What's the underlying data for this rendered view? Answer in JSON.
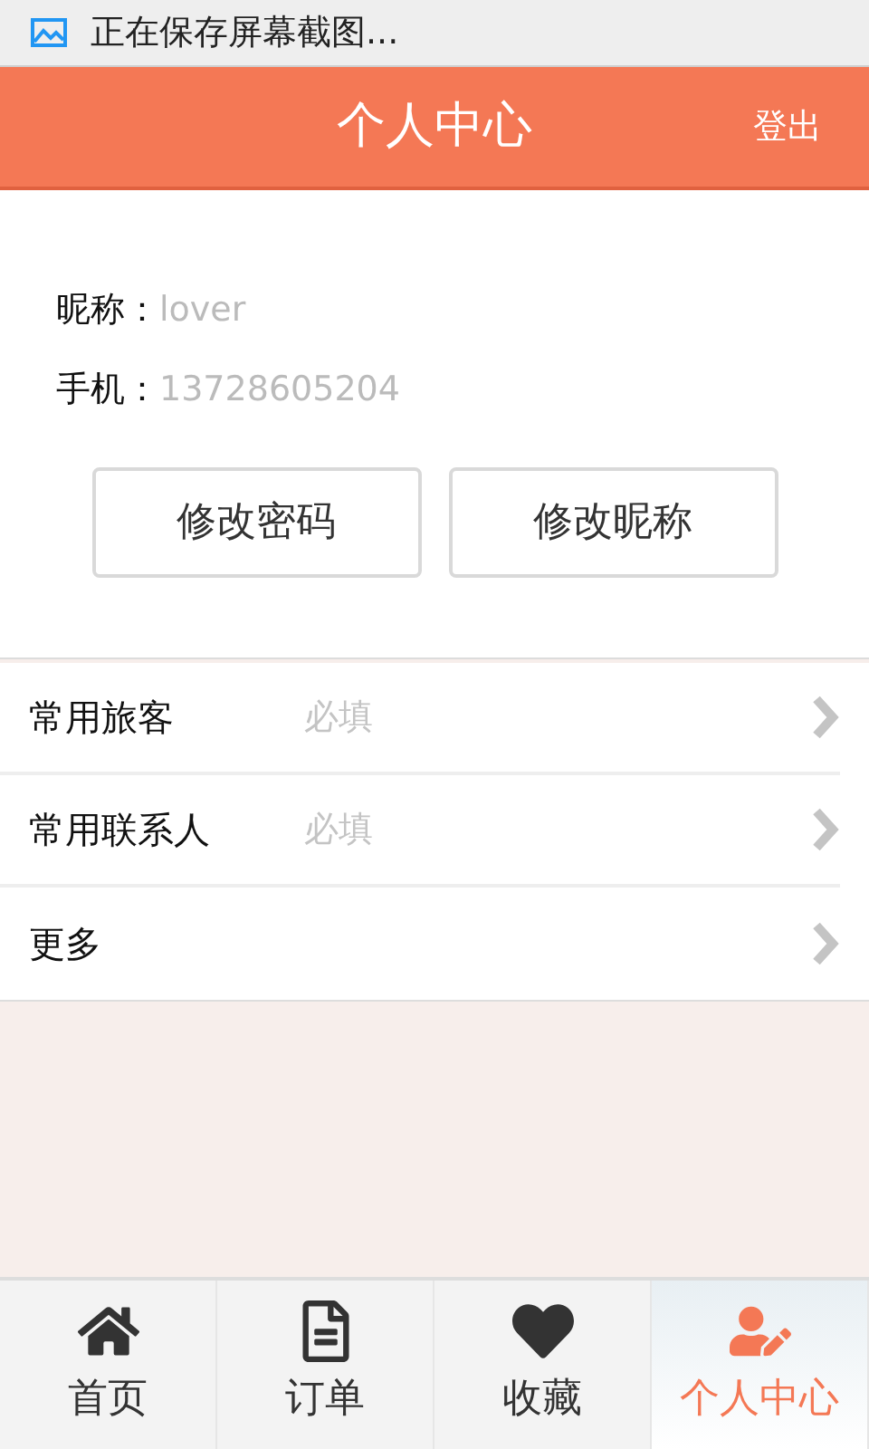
{
  "status_bar": {
    "notification": "正在保存屏幕截图..."
  },
  "header": {
    "title": "个人中心",
    "action": "登出"
  },
  "profile": {
    "fields": [
      {
        "label": "昵称：",
        "value": "lover"
      },
      {
        "label": "手机：",
        "value": "13728605204"
      }
    ],
    "buttons": [
      "修改密码",
      "修改昵称"
    ]
  },
  "menu": [
    {
      "label": "常用旅客",
      "hint": "必填"
    },
    {
      "label": "常用联系人",
      "hint": "必填"
    },
    {
      "label": "更多"
    }
  ],
  "tab_bar": [
    {
      "label": "首页",
      "selected": false
    },
    {
      "label": "订单",
      "selected": false
    },
    {
      "label": "收藏",
      "selected": false
    },
    {
      "label": "个人中心",
      "selected": true
    }
  ]
}
